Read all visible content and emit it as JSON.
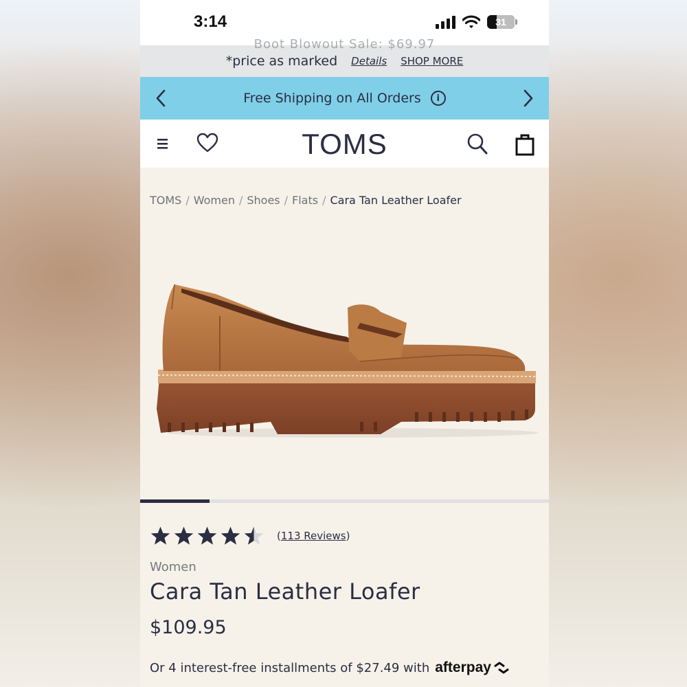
{
  "status_bar": {
    "time": "3:14",
    "battery": "31"
  },
  "promo": {
    "ghost_text": "Boot Blowout Sale: $69.97",
    "price_note": "*price as marked",
    "details_label": "Details",
    "shop_more_label": "SHOP MORE"
  },
  "shipping": {
    "message": "Free Shipping on All Orders"
  },
  "header": {
    "logo": "TOMS"
  },
  "breadcrumb": {
    "items": [
      "TOMS",
      "Women",
      "Shoes",
      "Flats"
    ],
    "current": "Cara Tan Leather Loafer"
  },
  "gallery": {
    "progress": 0.17
  },
  "product": {
    "rating": 4.5,
    "reviews_count": "113 Reviews",
    "category": "Women",
    "name": "Cara Tan Leather Loafer",
    "price": "$109.95",
    "installments_text": "Or 4 interest-free installments of $27.49 with",
    "afterpay_label": "afterpay"
  },
  "colors": {
    "navy": "#2b2d42",
    "shipping_bar": "#7fcfe8",
    "page_bg": "#f6f2ea",
    "leather": "#b8753f",
    "sole": "#8a4a2c"
  }
}
